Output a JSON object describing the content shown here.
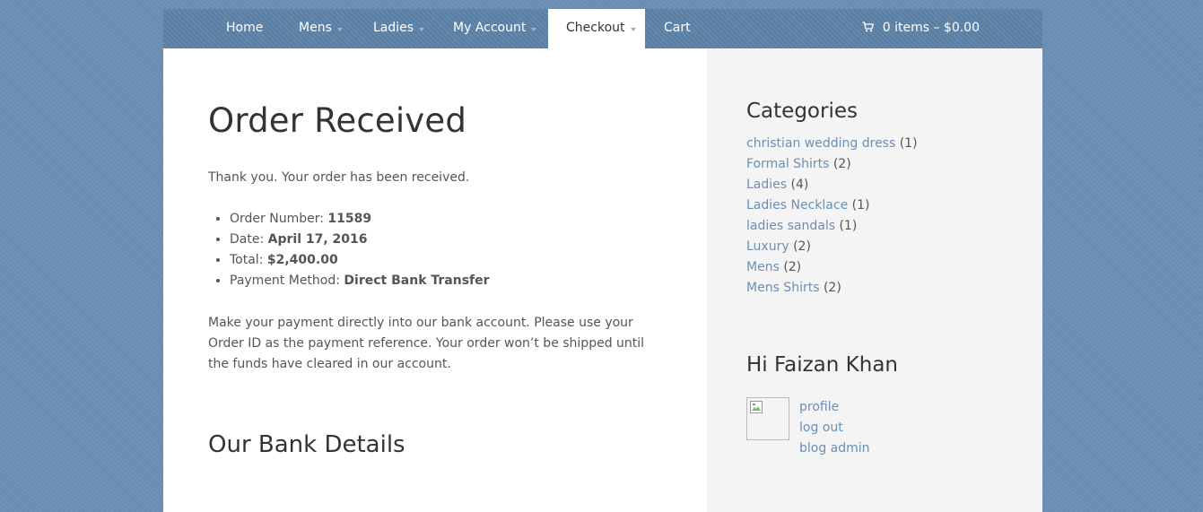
{
  "nav": {
    "items": [
      {
        "label": "Home",
        "dropdown": false
      },
      {
        "label": "Mens",
        "dropdown": true
      },
      {
        "label": "Ladies",
        "dropdown": true
      },
      {
        "label": "My Account",
        "dropdown": true
      },
      {
        "label": "Checkout",
        "dropdown": true,
        "active": true
      },
      {
        "label": "Cart",
        "dropdown": false
      }
    ],
    "cart_summary": "0 items – $0.00"
  },
  "main": {
    "title": "Order Received",
    "thanks": "Thank you. Your order has been received.",
    "details": [
      {
        "label": "Order Number: ",
        "value": "11589"
      },
      {
        "label": "Date: ",
        "value": "April 17, 2016"
      },
      {
        "label": "Total: ",
        "value": "$2,400.00"
      },
      {
        "label": "Payment Method: ",
        "value": "Direct Bank Transfer"
      }
    ],
    "payment_note": "Make your payment directly into our bank account. Please use your Order ID as the payment reference. Your order won’t be shipped until the funds have cleared in our account.",
    "bank_title": "Our Bank Details"
  },
  "sidebar": {
    "categories_title": "Categories",
    "categories": [
      {
        "name": "christian wedding dress",
        "count": "(1)"
      },
      {
        "name": "Formal Shirts",
        "count": "(2)"
      },
      {
        "name": "Ladies",
        "count": "(4)"
      },
      {
        "name": "Ladies Necklace",
        "count": "(1)"
      },
      {
        "name": "ladies sandals",
        "count": "(1)"
      },
      {
        "name": "Luxury",
        "count": "(2)"
      },
      {
        "name": "Mens",
        "count": "(2)"
      },
      {
        "name": "Mens Shirts",
        "count": "(2)"
      }
    ],
    "greeting": "Hi Faizan Khan",
    "user_links": [
      "profile",
      "log out",
      "blog admin"
    ]
  },
  "colors": {
    "background": "#6b8fb5",
    "nav": "#5e83a9",
    "link": "#6b8fb5",
    "sidebar": "#f4f4f4"
  }
}
